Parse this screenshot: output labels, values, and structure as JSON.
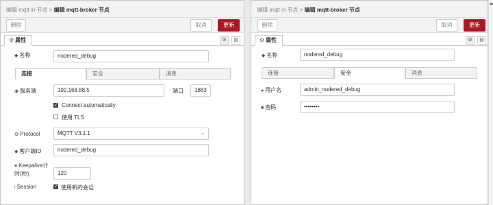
{
  "left": {
    "breadcrumb": {
      "parent": "编辑 mqtt in 节点",
      "sep": ">",
      "current": "编辑 mqtt-broker 节点"
    },
    "toolbar": {
      "delete": "删除",
      "cancel": "取消",
      "update": "更新"
    },
    "props_tab": {
      "label": "属性",
      "icon": "gear-icon"
    },
    "name": {
      "label": "名称",
      "icon": "tag-icon",
      "value": "nodered_debug"
    },
    "tabs": [
      "连接",
      "安全",
      "消息"
    ],
    "server": {
      "label": "服务端",
      "icon": "globe-icon",
      "value": "192.168.88.5",
      "port_label": "端口",
      "port": "1883"
    },
    "connect_auto": {
      "label": "Connect automatically",
      "checked": true
    },
    "use_tls": {
      "label": "使用 TLS",
      "checked": false
    },
    "protocol": {
      "label": "Protocol",
      "icon": "gear-icon",
      "value": "MQTT V3.1.1"
    },
    "client_id": {
      "label": "客户端ID",
      "icon": "tag-icon",
      "value": "nodered_debug"
    },
    "keepalive": {
      "label_line1": "Keepalive计",
      "label_line2": "时(秒)",
      "icon": "heart-icon",
      "value": "120"
    },
    "session": {
      "label": "Session",
      "icon": "info-icon",
      "option": "使用新的会话",
      "checked": true
    }
  },
  "right": {
    "breadcrumb": {
      "parent": "编辑 mqtt in 节点",
      "sep": ">",
      "current": "编辑 mqtt-broker 节点"
    },
    "toolbar": {
      "delete": "删除",
      "cancel": "取消",
      "update": "更新"
    },
    "props_tab": {
      "label": "属性",
      "icon": "gear-icon"
    },
    "name": {
      "label": "名称",
      "icon": "tag-icon",
      "value": "nodered_debug"
    },
    "tabs": [
      "连接",
      "安全",
      "消息"
    ],
    "username": {
      "label": "用户名",
      "icon": "user-icon",
      "value": "admin_nodered_debug"
    },
    "password": {
      "label": "密码",
      "icon": "lock-icon",
      "value": "••••••••"
    }
  },
  "colors": {
    "accent": "#ad1625",
    "header_bg": "#f3f3f3",
    "border": "#cccccc"
  }
}
